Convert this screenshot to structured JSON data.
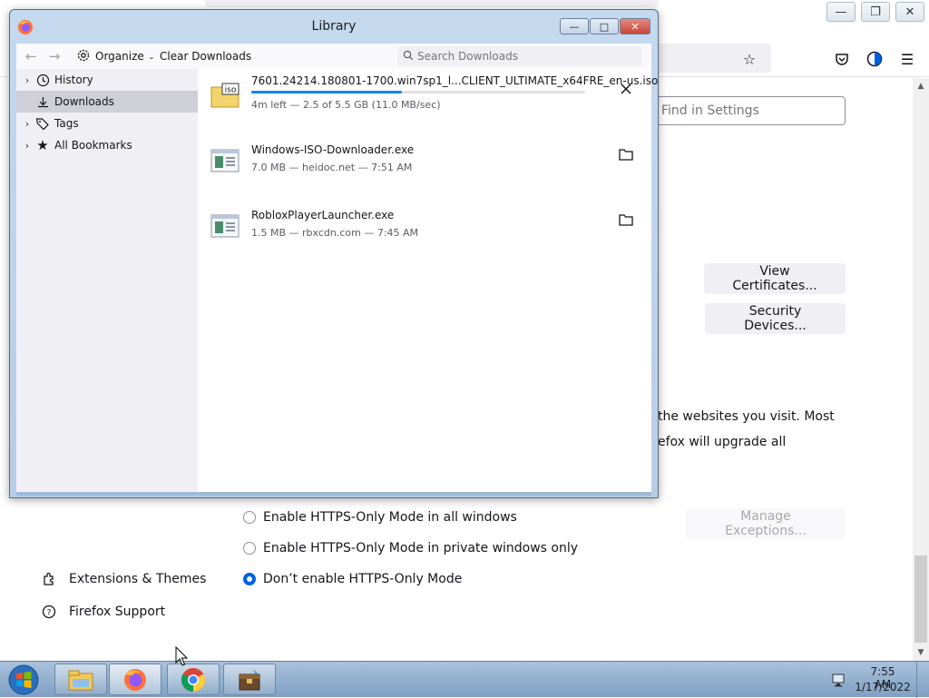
{
  "firefox": {
    "find_settings_placeholder": "Find in Settings",
    "view_certificates_label": "View Certificates...",
    "security_devices_label": "Security Devices...",
    "https_text_line1": "the websites you visit. Most",
    "https_text_line2": "efox will upgrade all",
    "manage_exceptions_label": "Manage Exceptions...",
    "radio_options": [
      {
        "label": "Enable HTTPS-Only Mode in all windows",
        "selected": false
      },
      {
        "label": "Enable HTTPS-Only Mode in private windows only",
        "selected": false
      },
      {
        "label": "Don’t enable HTTPS-Only Mode",
        "selected": true
      }
    ],
    "sidebar_links": [
      {
        "label": "Extensions & Themes",
        "icon": "puzzle-icon"
      },
      {
        "label": "Firefox Support",
        "icon": "help-icon"
      }
    ],
    "toolbar_icons": [
      "bookmark-star-icon",
      "pocket-icon",
      "theme-icon",
      "menu-icon"
    ]
  },
  "library": {
    "title": "Library",
    "toolbar": {
      "organize_label": "Organize",
      "clear_downloads_label": "Clear Downloads",
      "search_placeholder": "Search Downloads"
    },
    "sidebar": [
      {
        "label": "History",
        "icon": "clock-icon",
        "expandable": true
      },
      {
        "label": "Downloads",
        "icon": "download-icon",
        "expandable": false,
        "selected": true
      },
      {
        "label": "Tags",
        "icon": "tag-icon",
        "expandable": true
      },
      {
        "label": "All Bookmarks",
        "icon": "star-icon",
        "expandable": true
      }
    ],
    "downloads": [
      {
        "name": "7601.24214.180801-1700.win7sp1_l...CLIENT_ULTIMATE_x64FRE_en-us.iso",
        "status": "4m left — 2.5 of 5.5 GB (11.0 MB/sec)",
        "progress": 0.45,
        "icon": "iso-file-icon",
        "action": "cancel-icon"
      },
      {
        "name": "Windows-ISO-Downloader.exe",
        "status": "7.0 MB — heidoc.net — 7:51 AM",
        "icon": "exe-file-icon",
        "action": "folder-icon"
      },
      {
        "name": "RobloxPlayerLauncher.exe",
        "status": "1.5 MB — rbxcdn.com — 7:45 AM",
        "icon": "exe-file-icon",
        "action": "folder-icon"
      }
    ]
  },
  "taskbar": {
    "apps": [
      "explorer-icon",
      "firefox-icon",
      "chrome-icon",
      "archive-icon"
    ],
    "clock_time": "7:55 AM",
    "clock_date": "1/17/2022"
  },
  "colors": {
    "accent": "#0061e0",
    "progress": "#0a84ff",
    "aero_frame": "#b7cde6",
    "close_button": "#c9463d"
  }
}
